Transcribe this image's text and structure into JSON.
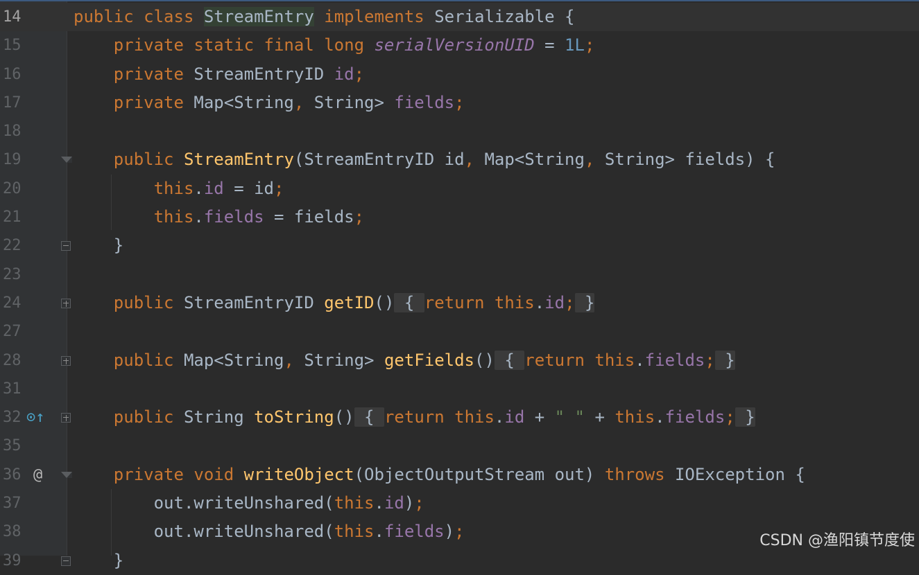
{
  "watermark": "CSDN @渔阳镇节度使",
  "lines": [
    {
      "n": "14",
      "parts": [
        [
          "kw",
          "public class "
        ],
        [
          "hl",
          "StreamEntry"
        ],
        [
          "cls",
          " "
        ],
        [
          "kw",
          "implements"
        ],
        [
          "cls",
          " Serializable {"
        ]
      ]
    },
    {
      "n": "15",
      "parts": [
        [
          "cls",
          "    "
        ],
        [
          "kw",
          "private static final long "
        ],
        [
          "ifld",
          "serialVersionUID"
        ],
        [
          "cls",
          " = "
        ],
        [
          "num",
          "1L"
        ],
        [
          "kw",
          ";"
        ]
      ]
    },
    {
      "n": "16",
      "parts": [
        [
          "cls",
          "    "
        ],
        [
          "kw",
          "private "
        ],
        [
          "cls",
          "StreamEntryID "
        ],
        [
          "fld",
          "id"
        ],
        [
          "kw",
          ";"
        ]
      ]
    },
    {
      "n": "17",
      "parts": [
        [
          "cls",
          "    "
        ],
        [
          "kw",
          "private "
        ],
        [
          "cls",
          "Map<String"
        ],
        [
          "kw",
          ", "
        ],
        [
          "cls",
          "String> "
        ],
        [
          "fld",
          "fields"
        ],
        [
          "kw",
          ";"
        ]
      ]
    },
    {
      "n": "18",
      "parts": []
    },
    {
      "n": "19",
      "parts": [
        [
          "cls",
          "    "
        ],
        [
          "kw",
          "public "
        ],
        [
          "fn",
          "StreamEntry"
        ],
        [
          "cls",
          "(StreamEntryID id"
        ],
        [
          "kw",
          ", "
        ],
        [
          "cls",
          "Map<String"
        ],
        [
          "kw",
          ", "
        ],
        [
          "cls",
          "String> fields) {"
        ]
      ]
    },
    {
      "n": "20",
      "parts": [
        [
          "cls",
          "        "
        ],
        [
          "kw",
          "this"
        ],
        [
          "cls",
          "."
        ],
        [
          "fld",
          "id"
        ],
        [
          "cls",
          " = id"
        ],
        [
          "kw",
          ";"
        ]
      ]
    },
    {
      "n": "21",
      "parts": [
        [
          "cls",
          "        "
        ],
        [
          "kw",
          "this"
        ],
        [
          "cls",
          "."
        ],
        [
          "fld",
          "fields"
        ],
        [
          "cls",
          " = fields"
        ],
        [
          "kw",
          ";"
        ]
      ]
    },
    {
      "n": "22",
      "parts": [
        [
          "cls",
          "    }"
        ]
      ]
    },
    {
      "n": "23",
      "parts": []
    },
    {
      "n": "24",
      "parts": [
        [
          "cls",
          "    "
        ],
        [
          "kw",
          "public "
        ],
        [
          "cls",
          "StreamEntryID "
        ],
        [
          "fn",
          "getID"
        ],
        [
          "cls",
          "()"
        ],
        [
          "folded",
          " { "
        ],
        [
          "kw",
          "return this"
        ],
        [
          "cls",
          "."
        ],
        [
          "fld",
          "id"
        ],
        [
          "kw",
          ";"
        ],
        [
          "folded",
          " }"
        ]
      ]
    },
    {
      "n": "27",
      "parts": []
    },
    {
      "n": "28",
      "parts": [
        [
          "cls",
          "    "
        ],
        [
          "kw",
          "public "
        ],
        [
          "cls",
          "Map<String"
        ],
        [
          "kw",
          ", "
        ],
        [
          "cls",
          "String> "
        ],
        [
          "fn",
          "getFields"
        ],
        [
          "cls",
          "()"
        ],
        [
          "folded",
          " { "
        ],
        [
          "kw",
          "return this"
        ],
        [
          "cls",
          "."
        ],
        [
          "fld",
          "fields"
        ],
        [
          "kw",
          ";"
        ],
        [
          "folded",
          " }"
        ]
      ]
    },
    {
      "n": "31",
      "parts": []
    },
    {
      "n": "32",
      "parts": [
        [
          "cls",
          "    "
        ],
        [
          "kw",
          "public "
        ],
        [
          "cls",
          "String "
        ],
        [
          "fn",
          "toString"
        ],
        [
          "cls",
          "()"
        ],
        [
          "folded",
          " { "
        ],
        [
          "kw",
          "return this"
        ],
        [
          "cls",
          "."
        ],
        [
          "fld",
          "id"
        ],
        [
          "cls",
          " + "
        ],
        [
          "str",
          "\" \""
        ],
        [
          "cls",
          " + "
        ],
        [
          "kw",
          "this"
        ],
        [
          "cls",
          "."
        ],
        [
          "fld",
          "fields"
        ],
        [
          "kw",
          ";"
        ],
        [
          "folded",
          " }"
        ]
      ]
    },
    {
      "n": "35",
      "parts": []
    },
    {
      "n": "36",
      "parts": [
        [
          "cls",
          "    "
        ],
        [
          "kw",
          "private void "
        ],
        [
          "fn",
          "writeObject"
        ],
        [
          "cls",
          "(ObjectOutputStream out) "
        ],
        [
          "kw",
          "throws "
        ],
        [
          "cls",
          "IOException {"
        ]
      ]
    },
    {
      "n": "37",
      "parts": [
        [
          "cls",
          "        out.writeUnshared("
        ],
        [
          "kw",
          "this"
        ],
        [
          "cls",
          "."
        ],
        [
          "fld",
          "id"
        ],
        [
          "cls",
          ")"
        ],
        [
          "kw",
          ";"
        ]
      ]
    },
    {
      "n": "38",
      "parts": [
        [
          "cls",
          "        out.writeUnshared("
        ],
        [
          "kw",
          "this"
        ],
        [
          "cls",
          "."
        ],
        [
          "fld",
          "fields"
        ],
        [
          "cls",
          ")"
        ],
        [
          "kw",
          ";"
        ]
      ]
    },
    {
      "n": "39",
      "parts": [
        [
          "cls",
          "    }"
        ]
      ]
    }
  ],
  "gutter_icons": {
    "32": [
      "override-icon",
      "⊙↑"
    ],
    "36": [
      "annotation-icon",
      "@"
    ]
  },
  "fold_markers": {
    "19": "open",
    "22": "minus",
    "24": "plus",
    "28": "plus",
    "32": "plus",
    "36": "open",
    "39": "minus"
  }
}
